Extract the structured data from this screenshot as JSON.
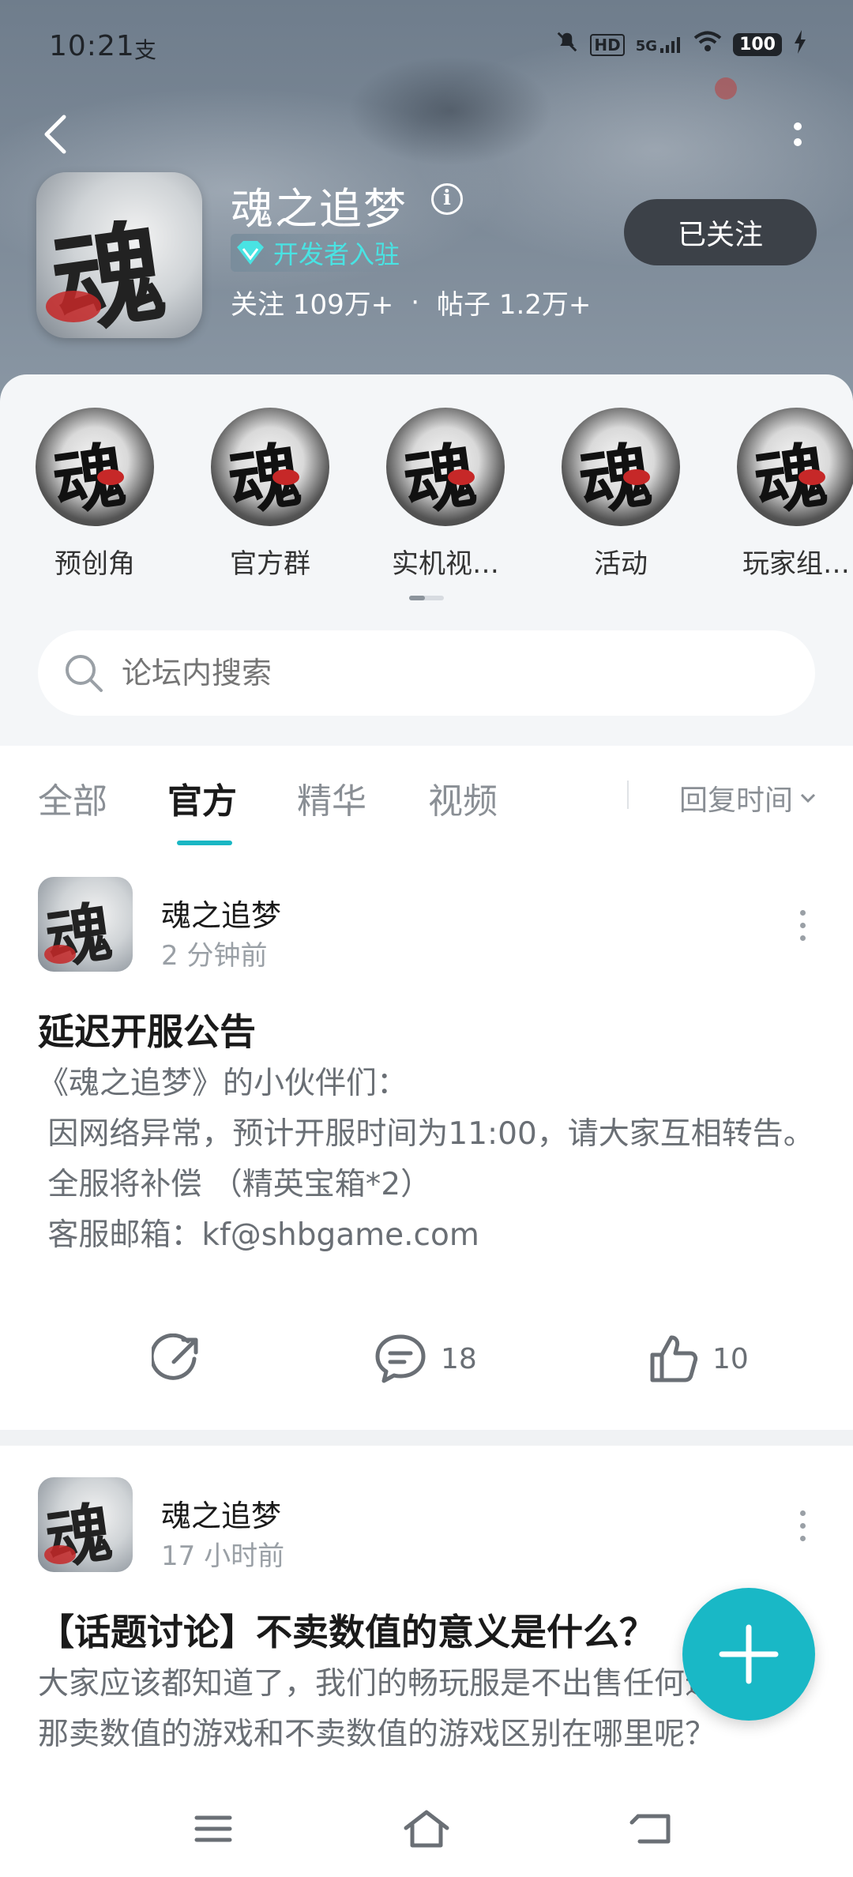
{
  "status_bar": {
    "time": "10:21",
    "extra": "支",
    "network": "5G",
    "battery": "100"
  },
  "forum": {
    "title": "魂之追梦",
    "developer_badge": "开发者入驻",
    "followers_label": "关注 109万+",
    "separator": "·",
    "posts_label": "帖子 1.2万+",
    "follow_button": "已关注"
  },
  "shortcuts": [
    {
      "label": "预创角"
    },
    {
      "label": "官方群"
    },
    {
      "label": "实机视…"
    },
    {
      "label": "活动"
    },
    {
      "label": "玩家组…"
    }
  ],
  "search": {
    "placeholder": "论坛内搜索"
  },
  "tabs": [
    {
      "label": "全部",
      "active": false
    },
    {
      "label": "官方",
      "active": true
    },
    {
      "label": "精华",
      "active": false
    },
    {
      "label": "视频",
      "active": false
    }
  ],
  "sort": {
    "label": "回复时间"
  },
  "posts": [
    {
      "author": "魂之追梦",
      "time": "2 分钟前",
      "title": "延迟开服公告",
      "body": "《魂之追梦》的小伙伴们：\n 因网络异常，预计开服时间为11:00，请大家互相转告。\n 全服将补偿 （精英宝箱*2）\n 客服邮箱：kf@shbgame.com",
      "comments": "18",
      "likes": "10"
    },
    {
      "author": "魂之追梦",
      "time": "17 小时前",
      "title": "【话题讨论】不卖数值的意义是什么？",
      "body": "大家应该都知道了，我们的畅玩服是不出售任何道具的。那卖数值的游戏和不卖数值的游戏区别在哪里呢？"
    }
  ],
  "colors": {
    "accent": "#19b8c6",
    "badge_text": "#49e3e3",
    "follow_bg": "#3c4148"
  }
}
